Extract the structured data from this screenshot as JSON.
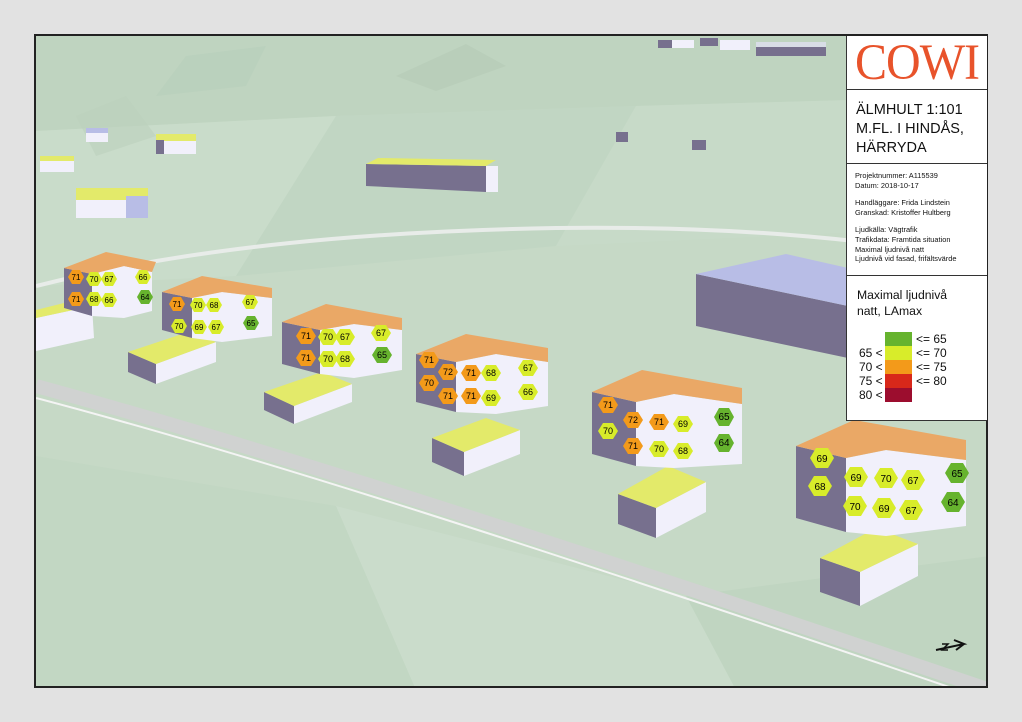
{
  "logo": {
    "text": "COWI",
    "color": "#e8532b"
  },
  "title_lines": [
    "ÄLMHULT 1:101",
    "M.FL. I HINDÅS,",
    "HÄRRYDA"
  ],
  "info": {
    "projektnummer": "Projektnummer: A115539",
    "datum": "Datum: 2018-10-17",
    "handlaggare": "Handläggare: Frida Lindstein",
    "granskad": "Granskad: Kristoffer Hultberg",
    "ljudkalla": "Ljudkälla: Vägtrafik",
    "trafikdata": "Trafikdata: Framtida situation",
    "maximal": "Maximal ljudnivå natt",
    "fasad": "Ljudnivå vid fasad, frifältsvärde"
  },
  "legend": {
    "title_line1": "Maximal ljudnivå",
    "title_line2": "natt, LAmax",
    "classes": [
      {
        "pre": "",
        "post": "<= 65",
        "color": "#66b32e"
      },
      {
        "pre": "65 <",
        "post": "<= 70",
        "color": "#d8ec2a"
      },
      {
        "pre": "70 <",
        "post": "<= 75",
        "color": "#f39a1a"
      },
      {
        "pre": "75 <",
        "post": "<= 80",
        "color": "#d8281a"
      },
      {
        "pre": "80 <",
        "post": "",
        "color": "#9c0d2e"
      }
    ]
  },
  "north_arrow": "north-arrow-icon",
  "colors": {
    "ground": "#c4d8c5",
    "road": "#d3d3d3",
    "building_side": "#77708e",
    "building_front": "#f1f0fb",
    "roof_flat": "#e3ea6a",
    "roof_tiled": "#eaa866",
    "far_block": "#b8bde6"
  },
  "labels": {
    "building_a": [
      "71",
      "70",
      "67",
      "66",
      "71",
      "68",
      "66",
      "64"
    ],
    "building_b": [
      "71",
      "70",
      "68",
      "67",
      "70",
      "69",
      "67",
      "65"
    ],
    "building_c": [
      "71",
      "70",
      "67",
      "67",
      "71",
      "70",
      "68",
      "65"
    ],
    "building_d": [
      "71",
      "72",
      "71",
      "68",
      "67",
      "70",
      "71",
      "71",
      "69",
      "66"
    ],
    "building_e": [
      "71",
      "72",
      "71",
      "69",
      "65",
      "70",
      "71",
      "70",
      "68",
      "64"
    ],
    "building_f": [
      "69",
      "69",
      "70",
      "67",
      "65",
      "68",
      "70",
      "69",
      "67",
      "64"
    ]
  }
}
